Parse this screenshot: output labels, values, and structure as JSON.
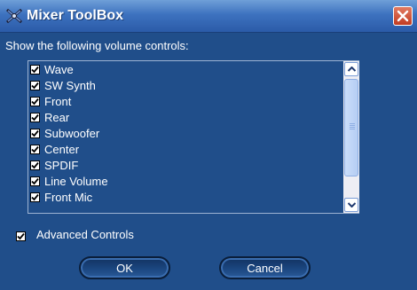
{
  "window": {
    "title": "Mixer ToolBox"
  },
  "prompt": "Show the following volume controls:",
  "controls": [
    {
      "label": "Wave",
      "checked": true
    },
    {
      "label": "SW Synth",
      "checked": true
    },
    {
      "label": "Front",
      "checked": true
    },
    {
      "label": "Rear",
      "checked": true
    },
    {
      "label": "Subwoofer",
      "checked": true
    },
    {
      "label": "Center",
      "checked": true
    },
    {
      "label": "SPDIF",
      "checked": true
    },
    {
      "label": "Line Volume",
      "checked": true
    },
    {
      "label": "Front Mic",
      "checked": true
    }
  ],
  "advanced": {
    "label": "Advanced Controls",
    "checked": true
  },
  "buttons": {
    "ok": "OK",
    "cancel": "Cancel"
  },
  "icons": {
    "app": "mixer-app-icon",
    "close": "close-icon",
    "up": "arrow-up-icon",
    "down": "arrow-down-icon"
  },
  "colors": {
    "background": "#204e8a",
    "title_bar": "#3d72bf",
    "close_button": "#c13c22",
    "text": "#ffffff"
  }
}
